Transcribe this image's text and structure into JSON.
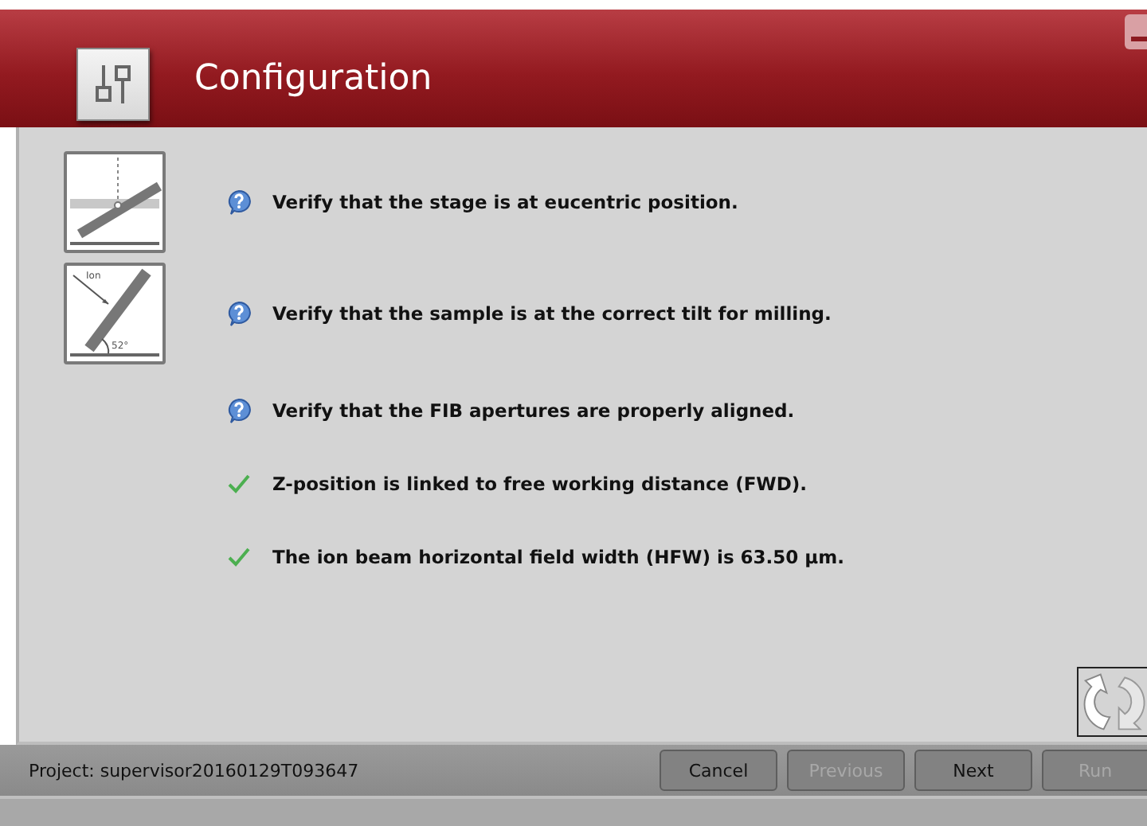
{
  "window": {
    "title": "Configuration"
  },
  "checks": [
    {
      "kind": "question",
      "text": "Verify that the stage is at eucentric position.",
      "diagram": {
        "kind": "eucentric"
      }
    },
    {
      "kind": "question",
      "text": "Verify that the sample is at the correct tilt for milling.",
      "diagram": {
        "kind": "tilt",
        "beam_label": "Ion",
        "angle_label": "52°"
      }
    },
    {
      "kind": "question",
      "text": "Verify that the FIB apertures are properly aligned."
    },
    {
      "kind": "done",
      "text": "Z-position is linked to free working distance (FWD)."
    },
    {
      "kind": "done",
      "text": "The ion beam horizontal field width (HFW) is 63.50 µm."
    }
  ],
  "status_bar": {
    "project": "Project: supervisor20160129T093647"
  },
  "buttons": [
    {
      "label": "Cancel",
      "disabled": false
    },
    {
      "label": "Previous",
      "disabled": true
    },
    {
      "label": "Next",
      "disabled": false
    },
    {
      "label": "Run",
      "disabled": true
    }
  ]
}
